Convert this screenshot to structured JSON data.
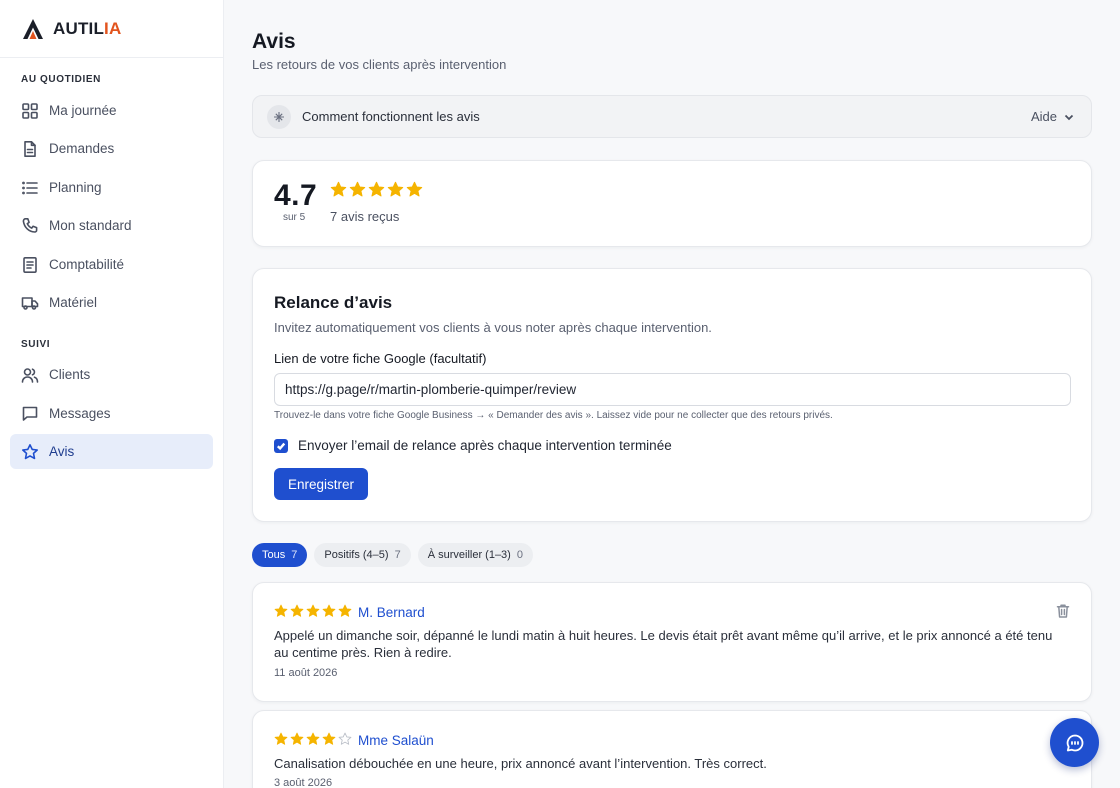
{
  "brand": {
    "name_main": "AUTIL",
    "name_accent": "IA",
    "accent_color": "#e2541e"
  },
  "sidebar": {
    "sections": [
      {
        "label": "AU QUOTIDIEN"
      },
      {
        "label": "SUIVI"
      }
    ],
    "items": [
      {
        "label": "Ma journée",
        "icon": "grid-icon"
      },
      {
        "label": "Demandes",
        "icon": "document-icon"
      },
      {
        "label": "Planning",
        "icon": "list-icon"
      },
      {
        "label": "Mon standard",
        "icon": "phone-icon"
      },
      {
        "label": "Comptabilité",
        "icon": "receipt-icon"
      },
      {
        "label": "Matériel",
        "icon": "truck-icon"
      },
      {
        "label": "Clients",
        "icon": "users-icon"
      },
      {
        "label": "Messages",
        "icon": "message-icon"
      },
      {
        "label": "Avis",
        "icon": "star-icon",
        "active": true
      }
    ]
  },
  "header": {
    "title": "Avis",
    "subtitle": "Les retours de vos clients après intervention"
  },
  "help": {
    "text": "Comment fonctionnent les avis",
    "right_label": "Aide"
  },
  "rating": {
    "value": "4.7",
    "scale": "sur 5",
    "stars_filled": 5,
    "count_label": "7 avis reçus",
    "star_color": "#f5b400"
  },
  "relance": {
    "title": "Relance d’avis",
    "description": "Invitez automatiquement vos clients à vous noter après chaque intervention.",
    "field_label": "Lien de votre fiche Google (facultatif)",
    "field_value": "https://g.page/r/martin-plomberie-quimper/review",
    "field_hint": "Trouvez-le dans votre fiche Google Business → « Demander des avis ». Laissez vide pour ne collecter que des retours privés.",
    "checkbox_label": "Envoyer l’email de relance après chaque intervention terminée",
    "checkbox_checked": true,
    "save_label": "Enregistrer"
  },
  "filters": [
    {
      "label": "Tous",
      "count": "7",
      "active": true
    },
    {
      "label": "Positifs (4–5)",
      "count": "7",
      "active": false
    },
    {
      "label": "À surveiller (1–3)",
      "count": "0",
      "active": false
    }
  ],
  "reviews": [
    {
      "stars": 5,
      "author": "M. Bernard",
      "text": "Appelé un dimanche soir, dépanné le lundi matin à huit heures. Le devis était prêt avant même qu’il arrive, et le prix annoncé a été tenu au centime près. Rien à redire.",
      "date": "11 août 2026"
    },
    {
      "stars": 4,
      "author": "Mme Salaün",
      "text": "Canalisation débouchée en une heure, prix annoncé avant l’intervention. Très correct.",
      "date": "3 août 2026"
    }
  ],
  "colors": {
    "primary": "#1f4fcf",
    "active_nav_bg": "#e7edfa"
  }
}
